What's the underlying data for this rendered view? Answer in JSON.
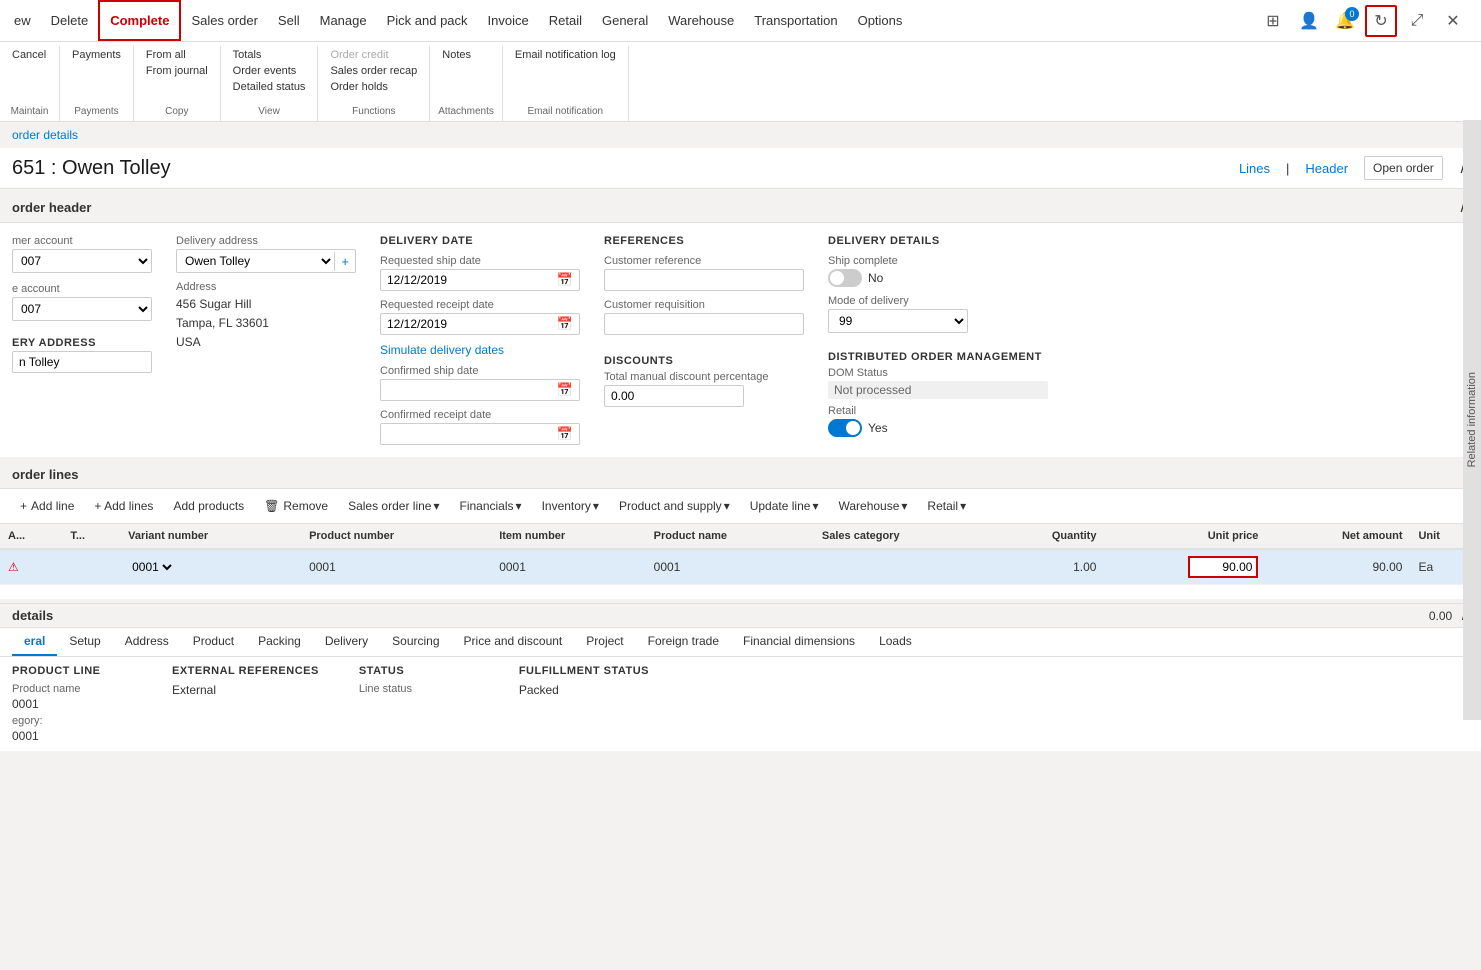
{
  "topNav": {
    "items": [
      {
        "id": "new",
        "label": "ew",
        "active": false
      },
      {
        "id": "delete",
        "label": "Delete",
        "active": false
      },
      {
        "id": "complete",
        "label": "Complete",
        "active": true
      },
      {
        "id": "sales-order",
        "label": "Sales order",
        "active": false
      },
      {
        "id": "sell",
        "label": "Sell",
        "active": false
      },
      {
        "id": "manage",
        "label": "Manage",
        "active": false
      },
      {
        "id": "pick-and-pack",
        "label": "Pick and pack",
        "active": false
      },
      {
        "id": "invoice",
        "label": "Invoice",
        "active": false
      },
      {
        "id": "retail",
        "label": "Retail",
        "active": false
      },
      {
        "id": "general",
        "label": "General",
        "active": false
      },
      {
        "id": "warehouse",
        "label": "Warehouse",
        "active": false
      },
      {
        "id": "transportation",
        "label": "Transportation",
        "active": false
      },
      {
        "id": "options",
        "label": "Options",
        "active": false
      }
    ]
  },
  "ribbon": {
    "groups": [
      {
        "id": "maintain",
        "label": "Maintain",
        "items": [
          {
            "id": "cancel",
            "label": "Cancel",
            "type": "small"
          }
        ]
      },
      {
        "id": "payments",
        "label": "Payments",
        "items": [
          {
            "id": "payments-btn",
            "label": "Payments",
            "type": "small"
          }
        ]
      },
      {
        "id": "copy",
        "label": "Copy",
        "items": [
          {
            "id": "from-all",
            "label": "From all",
            "type": "small"
          },
          {
            "id": "from-journal",
            "label": "From journal",
            "type": "small"
          }
        ]
      },
      {
        "id": "view",
        "label": "View",
        "items": [
          {
            "id": "totals",
            "label": "Totals",
            "type": "small"
          },
          {
            "id": "order-events",
            "label": "Order events",
            "type": "small"
          },
          {
            "id": "detailed-status",
            "label": "Detailed status",
            "type": "small"
          }
        ]
      },
      {
        "id": "functions",
        "label": "Functions",
        "items": [
          {
            "id": "order-credit",
            "label": "Order credit",
            "type": "small",
            "disabled": true
          },
          {
            "id": "sales-order-recap",
            "label": "Sales order recap",
            "type": "small"
          },
          {
            "id": "order-holds",
            "label": "Order holds",
            "type": "small"
          }
        ]
      },
      {
        "id": "attachments",
        "label": "Attachments",
        "items": [
          {
            "id": "notes",
            "label": "Notes",
            "type": "small"
          }
        ]
      },
      {
        "id": "email-notification",
        "label": "Email notification",
        "items": [
          {
            "id": "email-log",
            "label": "Email notification log",
            "type": "small"
          }
        ]
      }
    ]
  },
  "breadcrumb": "order details",
  "pageTitle": "651 : Owen Tolley",
  "pageTitleActions": {
    "lines": "Lines",
    "header": "Header",
    "openOrder": "Open order"
  },
  "orderHeader": {
    "sectionTitle": "order header",
    "customerAccount": {
      "label": "mer account",
      "value": "007"
    },
    "invoiceAccount": {
      "label": "e account",
      "value": "007"
    },
    "deliveryAddressLabel": "Delivery address",
    "deliveryAddressValue": "Owen Tolley",
    "addressLabel": "Address",
    "addressLine1": "456 Sugar Hill",
    "addressLine2": "Tampa, FL 33601",
    "addressLine3": "USA",
    "eryAddress": "ERY ADDRESS",
    "deliveryNameValue": "n Tolley",
    "deliveryDate": {
      "sectionTitle": "DELIVERY DATE",
      "requestedShipDate": {
        "label": "Requested ship date",
        "value": "12/12/2019"
      },
      "requestedReceiptDate": {
        "label": "Requested receipt date",
        "value": "12/12/2019"
      },
      "simulateLink": "Simulate delivery dates",
      "confirmedShipDate": {
        "label": "Confirmed ship date",
        "value": ""
      },
      "confirmedReceiptDate": {
        "label": "Confirmed receipt date",
        "value": ""
      }
    },
    "references": {
      "sectionTitle": "REFERENCES",
      "customerReference": {
        "label": "Customer reference",
        "value": ""
      },
      "customerRequisition": {
        "label": "Customer requisition",
        "value": ""
      }
    },
    "discounts": {
      "sectionTitle": "DISCOUNTS",
      "totalManualDiscountPct": {
        "label": "Total manual discount percentage",
        "value": "0.00"
      }
    },
    "deliveryDetails": {
      "sectionTitle": "DELIVERY DETAILS",
      "shipComplete": {
        "label": "Ship complete",
        "toggle": false,
        "text": "No"
      },
      "modeOfDelivery": {
        "label": "Mode of delivery",
        "value": "99"
      }
    },
    "domSection": {
      "sectionTitle": "DISTRIBUTED ORDER MANAGEMENT",
      "domStatus": {
        "label": "DOM Status",
        "value": "Not processed"
      },
      "retail": {
        "label": "Retail",
        "toggle": true,
        "text": "Yes"
      }
    }
  },
  "orderLines": {
    "sectionTitle": "order lines",
    "toolbar": {
      "addLine": "Add line",
      "addLines": "+ Add lines",
      "addProducts": "Add products",
      "remove": "Remove",
      "salesOrderLine": "Sales order line",
      "financials": "Financials",
      "inventory": "Inventory",
      "productAndSupply": "Product and supply",
      "updateLine": "Update line",
      "warehouse": "Warehouse",
      "retail": "Retail"
    },
    "columns": [
      {
        "id": "alert",
        "label": "A..."
      },
      {
        "id": "type",
        "label": "T..."
      },
      {
        "id": "variant",
        "label": "Variant number"
      },
      {
        "id": "product",
        "label": "Product number"
      },
      {
        "id": "item",
        "label": "Item number"
      },
      {
        "id": "name",
        "label": "Product name"
      },
      {
        "id": "category",
        "label": "Sales category"
      },
      {
        "id": "quantity",
        "label": "Quantity"
      },
      {
        "id": "unitprice",
        "label": "Unit price"
      },
      {
        "id": "netamount",
        "label": "Net amount"
      },
      {
        "id": "unit",
        "label": "Unit"
      }
    ],
    "rows": [
      {
        "alert": "⚠",
        "type": "",
        "variant": "0001",
        "product": "0001",
        "item": "0001",
        "name": "0001",
        "category": "",
        "quantity": "1.00",
        "unitprice": "90.00",
        "netamount": "90.00",
        "unit": "Ea"
      }
    ]
  },
  "details": {
    "sectionTitle": "details",
    "amount": "0.00",
    "tabs": [
      {
        "id": "general",
        "label": "eral",
        "active": true
      },
      {
        "id": "setup",
        "label": "Setup",
        "active": false
      },
      {
        "id": "address",
        "label": "Address",
        "active": false
      },
      {
        "id": "product",
        "label": "Product",
        "active": false
      },
      {
        "id": "packing",
        "label": "Packing",
        "active": false
      },
      {
        "id": "delivery",
        "label": "Delivery",
        "active": false
      },
      {
        "id": "sourcing",
        "label": "Sourcing",
        "active": false
      },
      {
        "id": "price-discount",
        "label": "Price and discount",
        "active": false
      },
      {
        "id": "project",
        "label": "Project",
        "active": false
      },
      {
        "id": "foreign-trade",
        "label": "Foreign trade",
        "active": false
      },
      {
        "id": "financial-dim",
        "label": "Financial dimensions",
        "active": false
      },
      {
        "id": "loads",
        "label": "Loads",
        "active": false
      }
    ],
    "productLine": {
      "sectionTitle": "PRODUCT LINE",
      "productNameLabel": "Product name",
      "productNameValue": "0001",
      "categoryLabel": "egory:",
      "categoryValue": "0001"
    },
    "externalRef": {
      "sectionTitle": "EXTERNAL REFERENCES",
      "externalLabel": "External"
    },
    "status": {
      "sectionTitle": "STATUS",
      "lineStatusLabel": "Line status"
    },
    "fulfillment": {
      "sectionTitle": "Fulfillment status",
      "packedLabel": "Packed"
    }
  },
  "rightPanel": {
    "label": "Related information"
  }
}
